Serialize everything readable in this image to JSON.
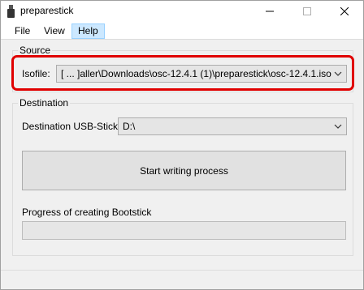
{
  "window": {
    "title": "preparestick",
    "icon": "usb-stick-icon"
  },
  "menu": {
    "file": "File",
    "view": "View",
    "help": "Help"
  },
  "source": {
    "group_label": "Source",
    "isofile_label": "Isofile:",
    "isofile_value": "[ ... ]aller\\Downloads\\osc-12.4.1 (1)\\preparestick\\osc-12.4.1.iso"
  },
  "destination": {
    "group_label": "Destination",
    "usb_label": "Destination USB-Stick:",
    "usb_value": "D:\\",
    "write_button": "Start writing process",
    "progress_label": "Progress of creating Bootstick",
    "progress_fraction": 0
  },
  "colors": {
    "highlight": "#e00000",
    "menu_active_bg": "#cce8ff"
  }
}
